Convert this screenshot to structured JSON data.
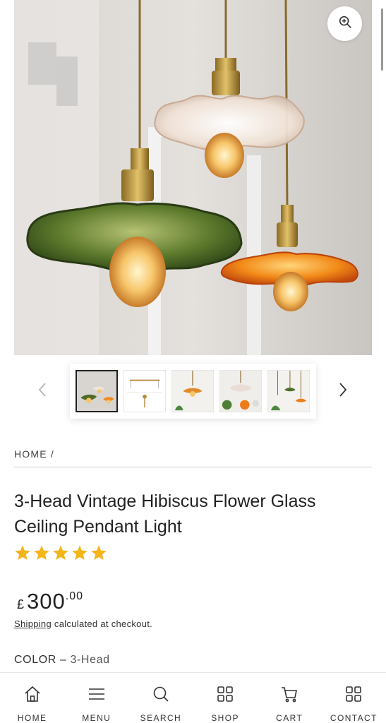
{
  "hero": {
    "image_alt": "Three hibiscus flower glass pendant lights: green, clear and amber shades with brass fittings"
  },
  "thumbnails": [
    {
      "name": "thumb-lamps-all",
      "active": true
    },
    {
      "name": "thumb-dimensions",
      "active": false
    },
    {
      "name": "thumb-amber-shade",
      "active": false
    },
    {
      "name": "thumb-clear-shade",
      "active": false
    },
    {
      "name": "thumb-lamps-trio",
      "active": false
    }
  ],
  "breadcrumb": {
    "home": "HOME",
    "separator": "/"
  },
  "product": {
    "title": "3-Head Vintage Hibiscus Flower Glass Ceiling Pendant Light",
    "rating_stars": 5,
    "currency": "£",
    "price_main": "300",
    "price_decimal": ".00",
    "shipping_link": "Shipping",
    "shipping_rest": " calculated at checkout.",
    "option_label": "COLOR",
    "option_sep": " – ",
    "option_value": "3-Head"
  },
  "nav": {
    "home": "HOME",
    "menu": "MENU",
    "search": "SEARCH",
    "shop": "SHOP",
    "cart": "CART",
    "contact": "CONTACT"
  },
  "colors": {
    "star": "#f4b51b",
    "text": "#222222"
  }
}
